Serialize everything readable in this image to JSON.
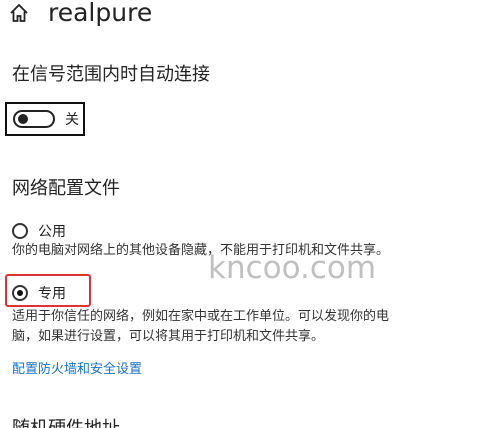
{
  "header": {
    "title": "realpure",
    "home_icon": "home-icon"
  },
  "auto_connect": {
    "title": "在信号范围内时自动连接",
    "toggle_state": "off",
    "toggle_label": "关"
  },
  "network_profile": {
    "title": "网络配置文件",
    "options": [
      {
        "label": "公用",
        "selected": false,
        "description": "你的电脑对网络上的其他设备隐藏，不能用于打印机和文件共享。"
      },
      {
        "label": "专用",
        "selected": true,
        "description_line1": "适用于你信任的网络，例如在家中或在工作单位。可以发现你的电",
        "description_line2": "脑，如果进行设置，可以将其用于打印机和文件共享。"
      }
    ],
    "firewall_link": "配置防火墙和安全设置"
  },
  "hardware_address": {
    "title": "随机硬件地址"
  },
  "watermark": "kncoo.com",
  "colors": {
    "link": "#1a73c8",
    "highlight": "#dd3333"
  }
}
